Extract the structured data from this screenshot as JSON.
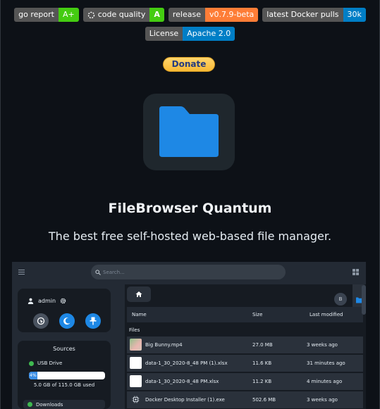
{
  "badges_row1": [
    {
      "label": "go report",
      "value": "A+",
      "color": "#4c1"
    },
    {
      "label": "code quality",
      "value": "A",
      "color": "#4c1"
    },
    {
      "label": "release",
      "value": "v0.7.9-beta",
      "color": "#fe7d37"
    },
    {
      "label": "latest Docker pulls",
      "value": "30k",
      "color": "#007ec6"
    }
  ],
  "badges_row2": [
    {
      "label": "License",
      "value": "Apache 2.0",
      "color": "#007ec6"
    }
  ],
  "donate_label": "Donate",
  "logo_icon": "folder-icon",
  "title": "FileBrowser Quantum",
  "tagline": "The best free self-hosted web-based file manager.",
  "screenshot": {
    "search_placeholder": "Search...",
    "user": {
      "name": "admin"
    },
    "sources": {
      "title": "Sources",
      "drives": [
        {
          "name": "USB Drive",
          "percent": "4%",
          "usage": "5.0 GB of 115.0 GB used",
          "fill_fraction": 0.04
        }
      ],
      "downloads": "Downloads"
    },
    "breadcrumb_icon": "home-icon",
    "avatar_letter": "B",
    "columns": {
      "name": "Name",
      "size": "Size",
      "modified": "Last modified"
    },
    "files_label": "Files",
    "files": [
      {
        "name": "Big Bunny.mp4",
        "size": "27.0 MB",
        "modified": "3 weeks ago",
        "icon": "video-thumbnail"
      },
      {
        "name": "data-1_30_2020-8_48 PM (1).xlsx",
        "size": "11.6 KB",
        "modified": "31 minutes ago",
        "icon": "spreadsheet-icon"
      },
      {
        "name": "data-1_30_2020-8_48 PM.xlsx",
        "size": "11.2 KB",
        "modified": "4 minutes ago",
        "icon": "spreadsheet-icon"
      },
      {
        "name": "Docker Desktop Installer (1).exe",
        "size": "502.6 MB",
        "modified": "3 weeks ago",
        "icon": "executable-icon"
      }
    ]
  }
}
